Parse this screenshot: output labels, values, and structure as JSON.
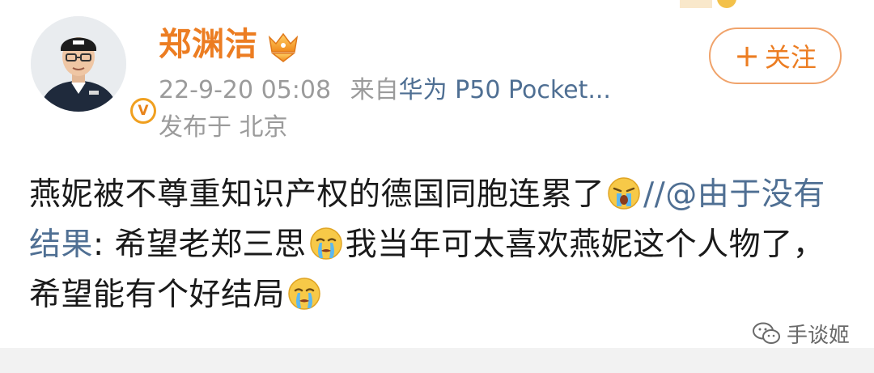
{
  "header": {
    "username": "郑渊洁",
    "timestamp": "22-9-20 05:08",
    "source_prefix": "来自",
    "source_device": "华为 P50 Pocket...",
    "location": "发布于 北京",
    "follow_label": "关注",
    "follow_icon": "plus-icon",
    "verified_badge_letter": "V"
  },
  "post": {
    "text_part1": "燕妮被不尊重知识产权的德国同胞连累了",
    "mention_sep": "//",
    "mention": "@由于没有结果",
    "text_part2": ": 希望老郑三思",
    "text_part3": "我当年可太喜欢燕妮这个人物了，希望能有个好结局",
    "emojis": [
      "crying-loudly-emoji",
      "crying-emoji",
      "crying-emoji"
    ]
  },
  "watermark": {
    "label": "手谈姬",
    "icon": "wechat-icon"
  },
  "colors": {
    "username": "#ec7d22",
    "link": "#4f6f93",
    "meta": "#9b9b9b",
    "follow_border": "#f0a36b"
  }
}
